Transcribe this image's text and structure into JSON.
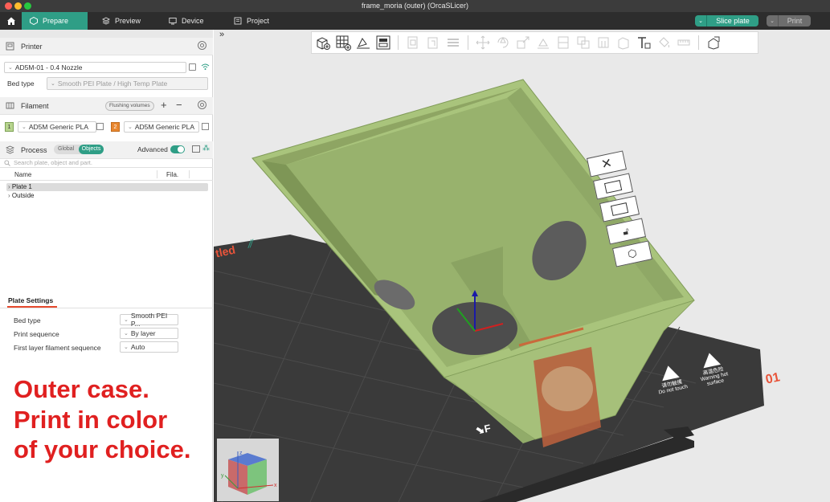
{
  "window": {
    "title": "frame_moria (outer) (OrcaSLicer)"
  },
  "tabs": [
    {
      "label": "Prepare"
    },
    {
      "label": "Preview"
    },
    {
      "label": "Device"
    },
    {
      "label": "Project"
    }
  ],
  "actions": {
    "slice_label": "Slice plate",
    "print_label": "Print"
  },
  "printer": {
    "section_label": "Printer",
    "name": "AD5M-01 - 0.4 Nozzle",
    "bed_type_label": "Bed type",
    "bed_type_value": "Smooth PEI Plate / High Temp Plate"
  },
  "filament": {
    "section_label": "Filament",
    "flushing_label": "Flushing volumes",
    "slots": [
      {
        "index": "1",
        "name": "AD5M Generic PLA",
        "color": "#b7d48e"
      },
      {
        "index": "2",
        "name": "AD5M Generic PLA",
        "color": "#e8862e"
      }
    ]
  },
  "process": {
    "section_label": "Process",
    "toggle_global": "Global",
    "toggle_objects": "Objects",
    "advanced_label": "Advanced",
    "search_placeholder": "Search plate, object and part.",
    "columns": {
      "name": "Name",
      "fila": "Fila."
    },
    "objects": [
      {
        "label": "Plate 1",
        "selected": true
      },
      {
        "label": "Outside",
        "selected": false
      }
    ]
  },
  "plate_settings": {
    "title": "Plate Settings",
    "rows": [
      {
        "label": "Bed type",
        "value": "Smooth PEI P..."
      },
      {
        "label": "Print sequence",
        "value": "By layer"
      },
      {
        "label": "First layer filament sequence",
        "value": "Auto"
      }
    ]
  },
  "annotation": {
    "lines": [
      "Outer case.",
      "Print in color",
      "of your choice."
    ],
    "color": "#e02020"
  },
  "viewport": {
    "plate_name_fragment": "tled",
    "plate_number": "01",
    "bed_warnings": [
      {
        "line1": "请勿触摸",
        "line2": "Do not touch"
      },
      {
        "line1": "高温危险",
        "line2": "Warning hot",
        "line3": "surface"
      }
    ],
    "axes": {
      "x": "x",
      "y": "y",
      "z": "z"
    }
  },
  "colors": {
    "accent": "#2f9e86",
    "model": "#a4bd77",
    "bed": "#3a3a3a"
  }
}
